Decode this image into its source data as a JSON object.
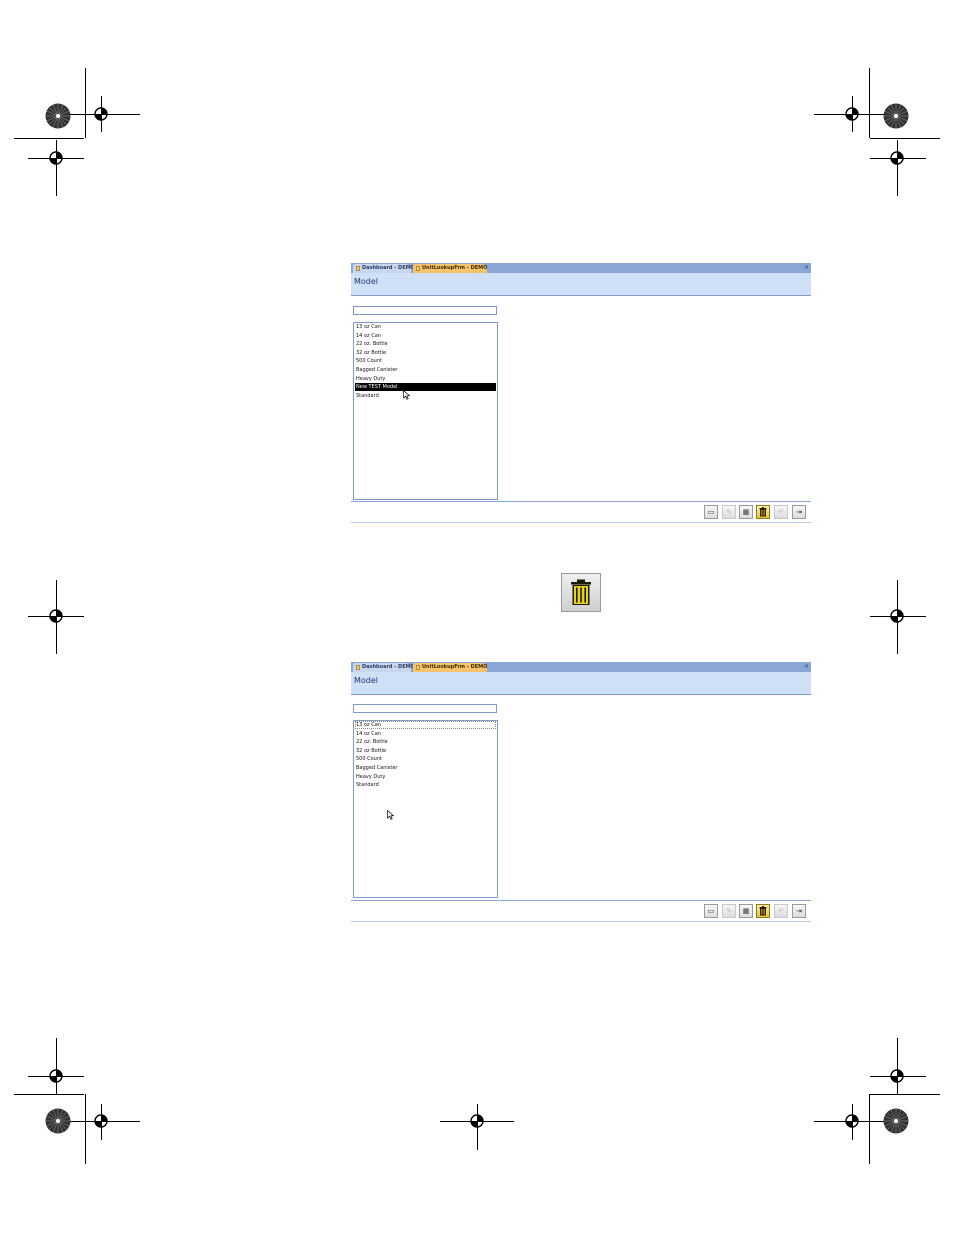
{
  "screens": [
    {
      "tabs": [
        {
          "label": "Dashboard - DEMO",
          "active": false
        },
        {
          "label": "UnitLookupFrm - DEMO",
          "active": true
        }
      ],
      "close_glyph": "×",
      "form_title": "Model",
      "search_value": "",
      "items": [
        {
          "label": "13 oz Can",
          "selected": false
        },
        {
          "label": "14 oz Can",
          "selected": false
        },
        {
          "label": "22 oz. Bottle",
          "selected": false
        },
        {
          "label": "32 oz Bottle",
          "selected": false
        },
        {
          "label": "500 Count",
          "selected": false
        },
        {
          "label": "Bagged Canister",
          "selected": false
        },
        {
          "label": "Heavy Duty",
          "selected": false
        },
        {
          "label": "New TEST Model",
          "selected": true
        },
        {
          "label": "Standard",
          "selected": false
        }
      ]
    },
    {
      "tabs": [
        {
          "label": "Dashboard - DEMO",
          "active": false
        },
        {
          "label": "UnitLookupFrm - DEMO",
          "active": true
        }
      ],
      "close_glyph": "×",
      "form_title": "Model",
      "search_value": "",
      "items": [
        {
          "label": "13 oz Can",
          "selected": false
        },
        {
          "label": "14 oz Can",
          "selected": false
        },
        {
          "label": "22 oz. Bottle",
          "selected": false
        },
        {
          "label": "32 oz Bottle",
          "selected": false
        },
        {
          "label": "500 Count",
          "selected": false
        },
        {
          "label": "Bagged Canister",
          "selected": false
        },
        {
          "label": "Heavy Duty",
          "selected": false
        },
        {
          "label": "Standard",
          "selected": false
        }
      ]
    }
  ],
  "toolbar_icons": [
    "new-record-icon",
    "edit-record-icon",
    "save-record-icon",
    "delete-record-icon",
    "undo-icon",
    "close-form-icon"
  ],
  "callout_icon": "trash-can-icon",
  "colors": {
    "tab_bar": "#8aa6d4",
    "header_bg": "#cfe0f7",
    "active_tab": "#f8c36a",
    "title_text": "#1e3a78",
    "selection": "#000000"
  }
}
